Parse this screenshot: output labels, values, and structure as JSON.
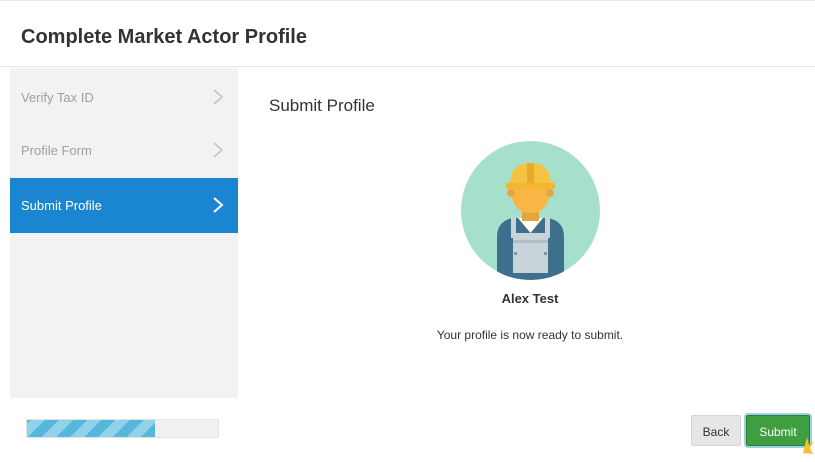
{
  "header": {
    "title": "Complete Market Actor Profile"
  },
  "steps": [
    {
      "label": "Verify Tax ID",
      "state": "completed"
    },
    {
      "label": "Profile Form",
      "state": "completed"
    },
    {
      "label": "Submit Profile",
      "state": "active"
    }
  ],
  "content": {
    "title": "Submit Profile",
    "avatar_icon": "construction-worker-avatar-icon",
    "user_name": "Alex Test",
    "status": "Your profile is now ready to submit."
  },
  "progress": {
    "fraction": 0.67
  },
  "buttons": {
    "back": "Back",
    "submit": "Submit"
  },
  "colors": {
    "active_step": "#1a85d0",
    "submit_button": "#3f9e3f",
    "avatar_bg": "#a6e0cc",
    "helmet": "#f5c242"
  }
}
